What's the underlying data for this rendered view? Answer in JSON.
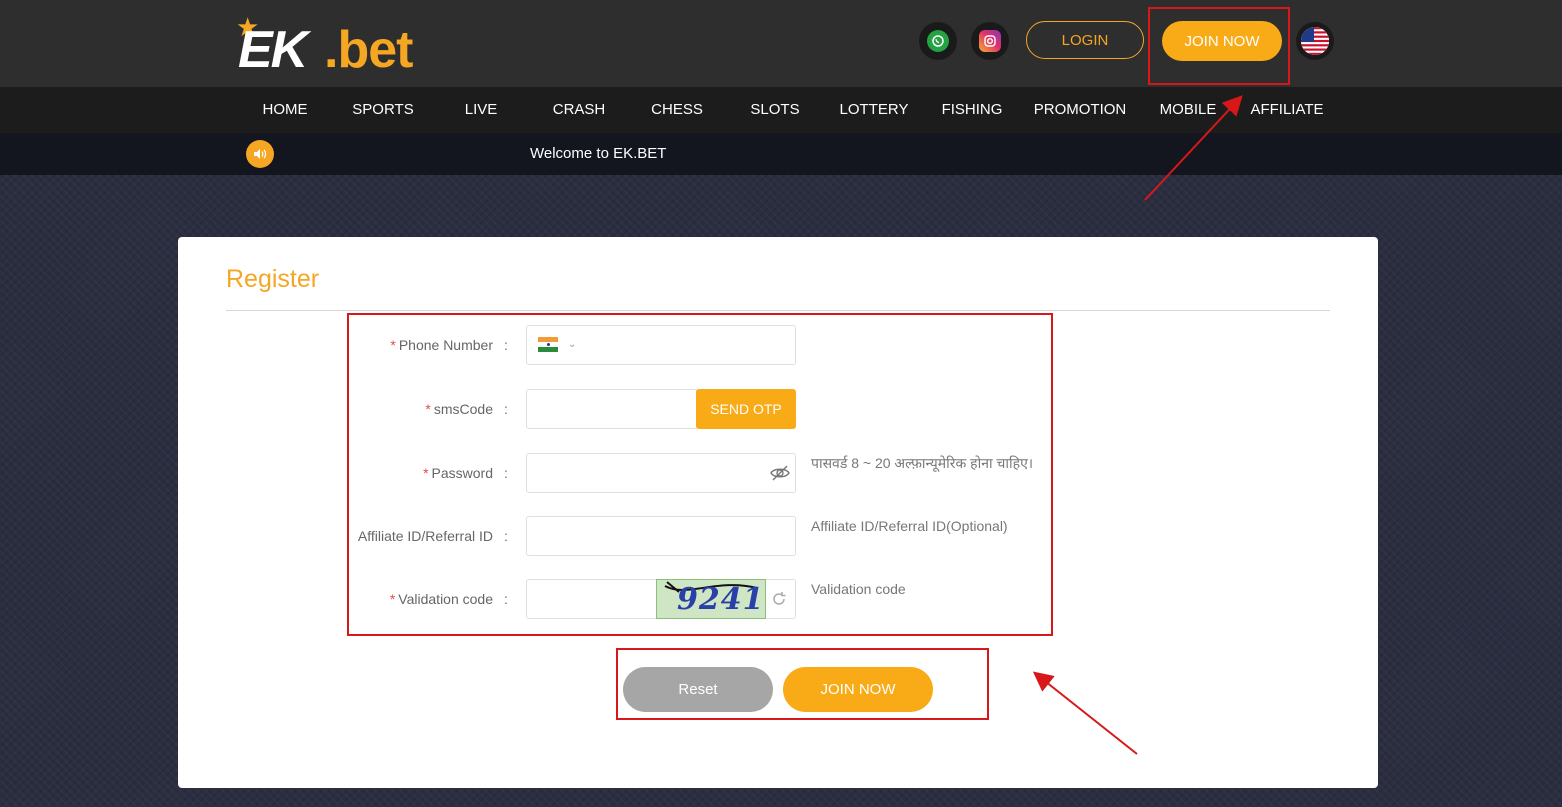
{
  "header": {
    "logo_ek": "EK",
    "logo_bet": ".bet",
    "login_label": "LOGIN",
    "join_label": "JOIN NOW",
    "social_icons": [
      "whatsapp-icon",
      "instagram-icon"
    ],
    "language_flag": "us-flag-icon"
  },
  "nav": {
    "items": [
      "HOME",
      "SPORTS",
      "LIVE",
      "CRASH",
      "CHESS",
      "SLOTS",
      "LOTTERY",
      "FISHING",
      "PROMOTION",
      "MOBILE",
      "AFFILIATE"
    ]
  },
  "ticker": {
    "icon": "speaker-icon",
    "text": "Welcome to EK.BET"
  },
  "register": {
    "title": "Register",
    "fields": {
      "phone": {
        "label": "Phone Number",
        "required": true,
        "country_flag": "india-flag-icon",
        "value": ""
      },
      "sms": {
        "label": "smsCode",
        "required": true,
        "button": "SEND OTP",
        "value": ""
      },
      "password": {
        "label": "Password",
        "required": true,
        "hint": "पासवर्ड 8 ~ 20 अल्फ़ान्यूमेरिक होना चाहिए।",
        "value": ""
      },
      "affiliate": {
        "label": "Affiliate ID/Referral ID",
        "required": false,
        "hint": "Affiliate ID/Referral ID(Optional)",
        "value": ""
      },
      "validation": {
        "label": "Validation code",
        "required": true,
        "captcha": "9241",
        "hint": "Validation code",
        "value": ""
      }
    },
    "colon": ":",
    "required_mark": "*",
    "reset_label": "Reset",
    "join_label": "JOIN NOW"
  },
  "colors": {
    "accent": "#f8ab17",
    "header_bg": "#2e2e2e",
    "nav_bg": "#1c1c1c",
    "annotation": "#d81818"
  }
}
